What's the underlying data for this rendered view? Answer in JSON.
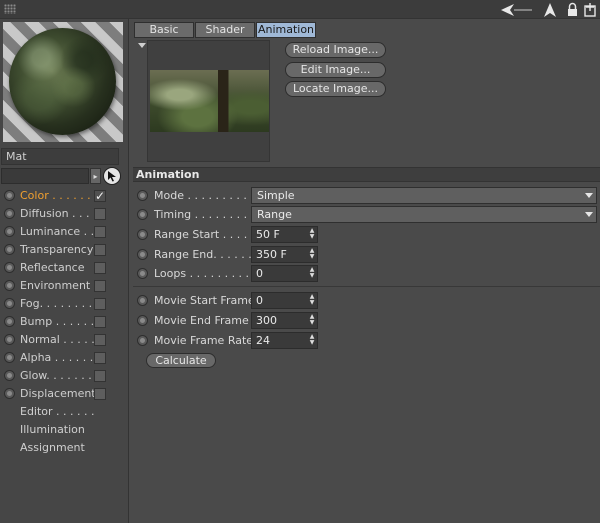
{
  "toolbar": {
    "icons": [
      "back-arrow-icon",
      "cursor-arrow-icon",
      "lock-icon",
      "new-window-icon"
    ]
  },
  "material": {
    "name": "Mat",
    "link_value": ""
  },
  "channels": [
    {
      "label": "Color . . . . . .",
      "checked": true,
      "active": true
    },
    {
      "label": "Diffusion . . .",
      "checked": false
    },
    {
      "label": "Luminance . .",
      "checked": false
    },
    {
      "label": "Transparency",
      "checked": false
    },
    {
      "label": "Reflectance",
      "checked": false
    },
    {
      "label": "Environment",
      "checked": false
    },
    {
      "label": "Fog. . . . . . . .",
      "checked": false
    },
    {
      "label": "Bump . . . . . .",
      "checked": false
    },
    {
      "label": "Normal . . . . .",
      "checked": false
    },
    {
      "label": "Alpha . . . . . .",
      "checked": false
    },
    {
      "label": "Glow. . . . . . .",
      "checked": false
    },
    {
      "label": "Displacement",
      "checked": false
    },
    {
      "label": "Editor . . . . . ."
    },
    {
      "label": "Illumination"
    },
    {
      "label": "Assignment"
    }
  ],
  "tabs": [
    "Basic",
    "Shader",
    "Animation"
  ],
  "active_tab": "Animation",
  "image_buttons": [
    "Reload Image...",
    "Edit Image...",
    "Locate Image..."
  ],
  "section_title": "Animation",
  "params": {
    "mode": {
      "label": "Mode . . . . . . . . . .",
      "value": "Simple"
    },
    "timing": {
      "label": "Timing . . . . . . . . .",
      "value": "Range"
    },
    "range_start": {
      "label": "Range Start . . . . .",
      "value": "50 F"
    },
    "range_end": {
      "label": "Range End. . . . . .",
      "value": "350 F"
    },
    "loops": {
      "label": "Loops . . . . . . . . . .",
      "value": "0"
    },
    "movie_start": {
      "label": "Movie Start Frame",
      "value": "0"
    },
    "movie_end": {
      "label": "Movie End Frame",
      "value": "300"
    },
    "movie_rate": {
      "label": "Movie Frame Rate",
      "value": "24"
    }
  },
  "calculate_label": "Calculate",
  "colors": {
    "active_channel": "#f0a030",
    "active_tab": "#9fb8d6",
    "background": "#4a4a4a"
  }
}
